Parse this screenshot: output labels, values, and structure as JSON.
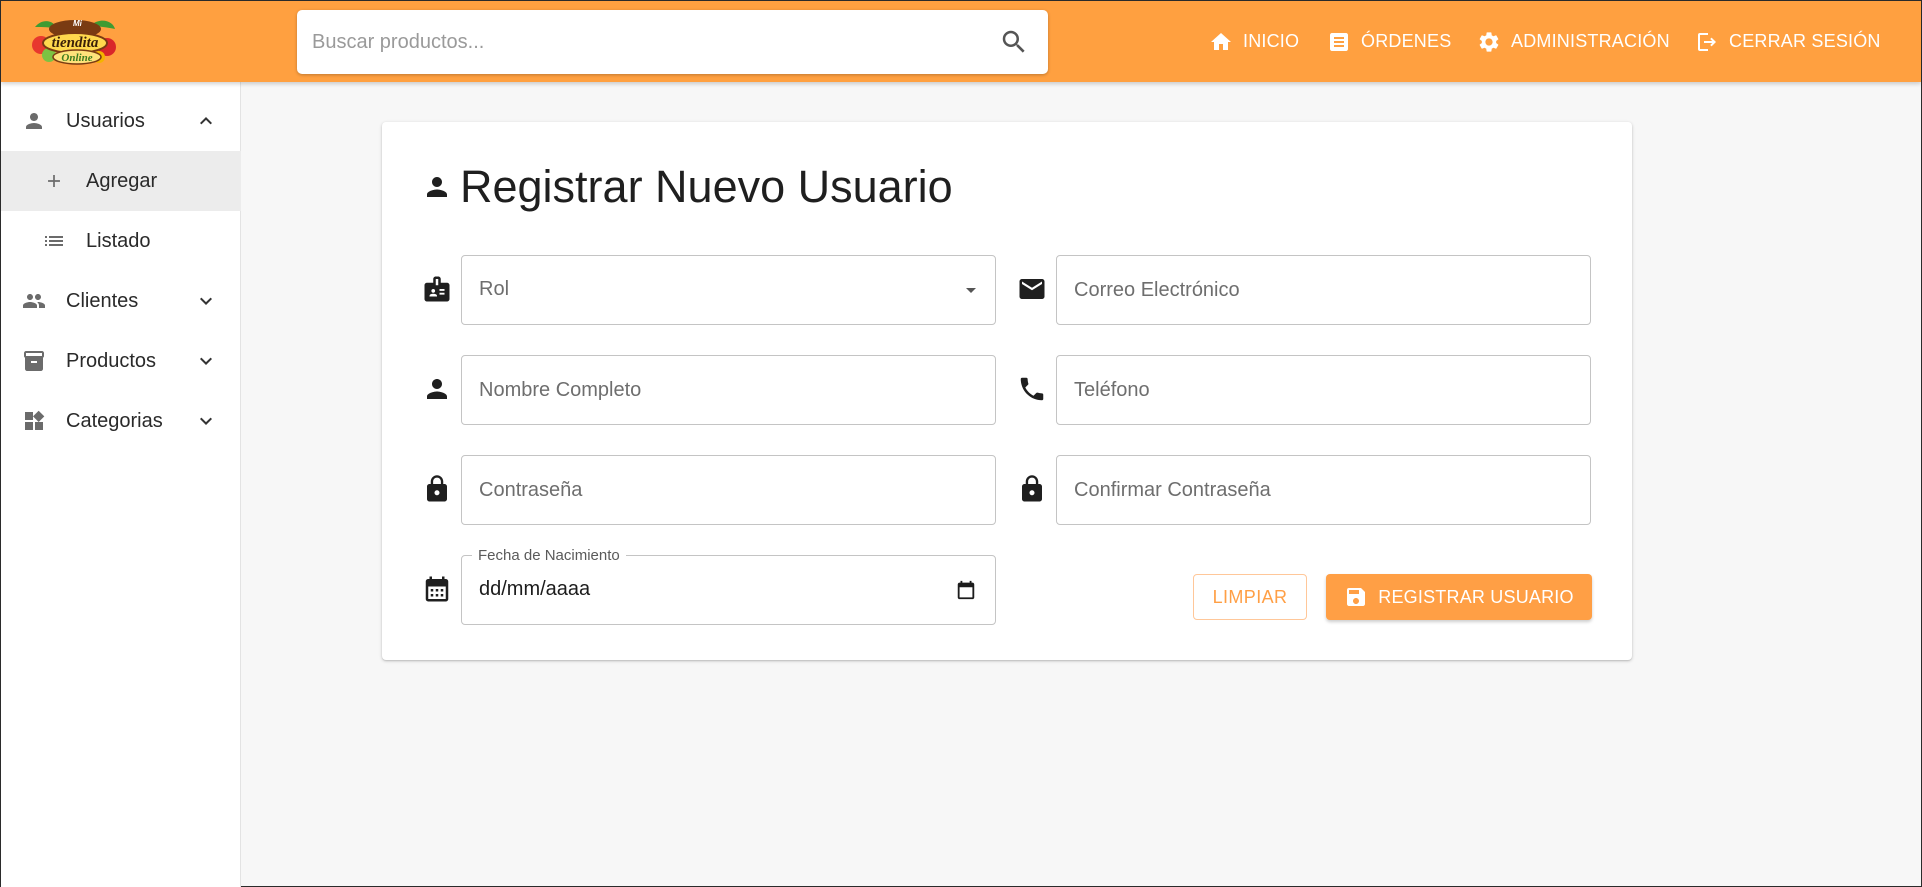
{
  "brand": {
    "logo_text_top": "Mi",
    "logo_text_mid": "tiendita",
    "logo_text_bottom": "Online"
  },
  "search": {
    "placeholder": "Buscar productos...",
    "icon": "search-icon"
  },
  "nav": {
    "inicio": "INICIO",
    "ordenes": "ÓRDENES",
    "administracion": "ADMINISTRACIÓN",
    "cerrar_sesion": "CERRAR SESIÓN"
  },
  "sidebar": {
    "items": [
      {
        "label": "Usuarios",
        "icon": "person-icon",
        "expanded": true
      },
      {
        "label": "Agregar",
        "icon": "plus-icon",
        "active": true
      },
      {
        "label": "Listado",
        "icon": "list-icon"
      },
      {
        "label": "Clientes",
        "icon": "people-icon",
        "expanded": false
      },
      {
        "label": "Productos",
        "icon": "archive-icon",
        "expanded": false
      },
      {
        "label": "Categorias",
        "icon": "dashboard-icon",
        "expanded": false
      }
    ]
  },
  "form": {
    "title": "Registrar Nuevo Usuario",
    "rol_placeholder": "Rol",
    "email_placeholder": "Correo Electrónico",
    "nombre_placeholder": "Nombre Completo",
    "telefono_placeholder": "Teléfono",
    "password_placeholder": "Contraseña",
    "confirm_placeholder": "Confirmar Contraseña",
    "fecha_label": "Fecha de Nacimiento",
    "fecha_value": "dd/mm/aaaa",
    "clear_label": "LIMPIAR",
    "submit_label": "REGISTRAR USUARIO"
  },
  "colors": {
    "brand": "#ffa040",
    "button": "#ff9f45",
    "background": "#f7f7f7"
  }
}
